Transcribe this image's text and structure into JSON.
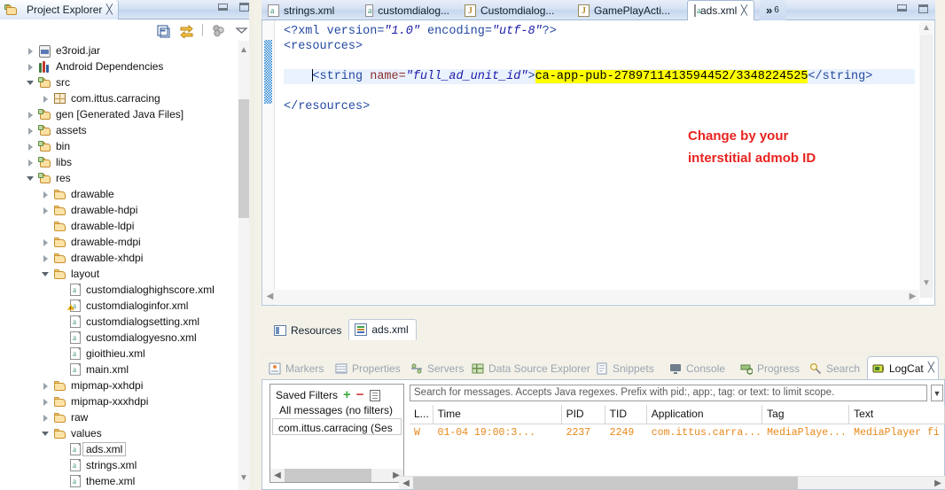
{
  "explorer": {
    "tab_title": "Project Explorer",
    "close_icon": "close-icon",
    "toolbar": [
      {
        "name": "collapse-all-icon",
        "tip": "Collapse All"
      },
      {
        "name": "link-with-editor-icon",
        "tip": "Link with Editor"
      },
      {
        "name": "filter-icon",
        "tip": "Filters"
      },
      {
        "name": "view-menu-icon",
        "tip": "View Menu"
      }
    ],
    "tree": [
      {
        "label": "e3roid.jar",
        "indent": 1,
        "twisty": "closed",
        "icon": "jar-icon"
      },
      {
        "label": "Android Dependencies",
        "indent": 1,
        "twisty": "closed",
        "icon": "library-icon"
      },
      {
        "label": "src",
        "indent": 1,
        "twisty": "open",
        "icon": "source-folder-icon"
      },
      {
        "label": "com.ittus.carracing",
        "indent": 2,
        "twisty": "closed",
        "icon": "package-icon"
      },
      {
        "label": "gen [Generated Java Files]",
        "indent": 1,
        "twisty": "closed",
        "icon": "source-folder-icon"
      },
      {
        "label": "assets",
        "indent": 1,
        "twisty": "closed",
        "icon": "source-folder-icon"
      },
      {
        "label": "bin",
        "indent": 1,
        "twisty": "closed",
        "icon": "source-folder-icon"
      },
      {
        "label": "libs",
        "indent": 1,
        "twisty": "closed",
        "icon": "source-folder-icon"
      },
      {
        "label": "res",
        "indent": 1,
        "twisty": "open",
        "icon": "source-folder-icon"
      },
      {
        "label": "drawable",
        "indent": 2,
        "twisty": "closed",
        "icon": "folder-icon"
      },
      {
        "label": "drawable-hdpi",
        "indent": 2,
        "twisty": "closed",
        "icon": "folder-icon"
      },
      {
        "label": "drawable-ldpi",
        "indent": 2,
        "twisty": "none",
        "icon": "folder-icon"
      },
      {
        "label": "drawable-mdpi",
        "indent": 2,
        "twisty": "closed",
        "icon": "folder-icon"
      },
      {
        "label": "drawable-xhdpi",
        "indent": 2,
        "twisty": "closed",
        "icon": "folder-icon"
      },
      {
        "label": "layout",
        "indent": 2,
        "twisty": "open",
        "icon": "folder-icon"
      },
      {
        "label": "customdialoghighscore.xml",
        "indent": 3,
        "twisty": "none",
        "icon": "xml-file-icon"
      },
      {
        "label": "customdialoginfor.xml",
        "indent": 3,
        "twisty": "none",
        "icon": "xml-file-warning-icon"
      },
      {
        "label": "customdialogsetting.xml",
        "indent": 3,
        "twisty": "none",
        "icon": "xml-file-icon"
      },
      {
        "label": "customdialogyesno.xml",
        "indent": 3,
        "twisty": "none",
        "icon": "xml-file-icon"
      },
      {
        "label": "gioithieu.xml",
        "indent": 3,
        "twisty": "none",
        "icon": "xml-file-icon"
      },
      {
        "label": "main.xml",
        "indent": 3,
        "twisty": "none",
        "icon": "xml-file-icon"
      },
      {
        "label": "mipmap-xxhdpi",
        "indent": 2,
        "twisty": "closed",
        "icon": "folder-icon"
      },
      {
        "label": "mipmap-xxxhdpi",
        "indent": 2,
        "twisty": "closed",
        "icon": "folder-icon"
      },
      {
        "label": "raw",
        "indent": 2,
        "twisty": "closed",
        "icon": "folder-icon"
      },
      {
        "label": "values",
        "indent": 2,
        "twisty": "open",
        "icon": "folder-icon"
      },
      {
        "label": "ads.xml",
        "indent": 3,
        "twisty": "none",
        "icon": "xml-file-icon",
        "selected": true
      },
      {
        "label": "strings.xml",
        "indent": 3,
        "twisty": "none",
        "icon": "xml-file-icon"
      },
      {
        "label": "theme.xml",
        "indent": 3,
        "twisty": "none",
        "icon": "xml-file-icon"
      }
    ]
  },
  "editor": {
    "tabs": [
      {
        "label": "strings.xml",
        "icon": "xml-file-icon",
        "active": false
      },
      {
        "label": "customdialog...",
        "icon": "xml-file-icon",
        "active": false
      },
      {
        "label": "Customdialog...",
        "icon": "java-file-icon",
        "active": false
      },
      {
        "label": "GamePlayActi...",
        "icon": "java-file-icon",
        "active": false
      },
      {
        "label": "ads.xml",
        "icon": "xml-file-icon",
        "active": true
      }
    ],
    "overflow_label": "»",
    "overflow_count": "6",
    "code": {
      "line1_decl": "<?xml version=",
      "line1_ver": "\"1.0\"",
      "line1_enc_attr": " encoding=",
      "line1_enc": "\"utf-8\"",
      "line1_end": "?>",
      "line2": "<resources>",
      "line4_tag_open": "<string ",
      "line4_attr": "name=",
      "line4_attr_val": "\"full_ad_unit_id\"",
      "line4_gt": ">",
      "line4_value": "ca-app-pub-2789711413594452/3348224525",
      "line4_close": "</string>",
      "line6": "</resources>"
    },
    "annotation_line1": "Change by your",
    "annotation_line2": "interstitial admob ID",
    "annotation_color": "#e8231f",
    "highlight_color": "#ffff00",
    "bottom_tabs": [
      {
        "label": "Resources",
        "icon": "resources-form-icon",
        "active": false
      },
      {
        "label": "ads.xml",
        "icon": "source-view-icon",
        "active": true
      }
    ]
  },
  "bottom_panel": {
    "tabs": [
      {
        "label": "Markers",
        "icon": "markers-icon",
        "active": false
      },
      {
        "label": "Properties",
        "icon": "properties-icon",
        "active": false
      },
      {
        "label": "Servers",
        "icon": "servers-icon",
        "active": false
      },
      {
        "label": "Data Source Explorer",
        "icon": "data-source-icon",
        "active": false
      },
      {
        "label": "Snippets",
        "icon": "snippets-icon",
        "active": false
      },
      {
        "label": "Console",
        "icon": "console-icon",
        "active": false
      },
      {
        "label": "Progress",
        "icon": "progress-icon",
        "active": false
      },
      {
        "label": "Search",
        "icon": "search-icon",
        "active": false
      },
      {
        "label": "LogCat",
        "icon": "logcat-icon",
        "active": true
      }
    ],
    "logcat": {
      "filters_title": "Saved Filters",
      "add_filter": "+",
      "remove_filter": "−",
      "edit_filter_icon": "edit-filter-icon",
      "filters": [
        {
          "label": "All messages (no filters)",
          "selected": false
        },
        {
          "label": "com.ittus.carracing (Ses",
          "selected": true
        }
      ],
      "search_placeholder": "Search for messages. Accepts Java regexes. Prefix with pid:, app:, tag: or text: to limit scope.",
      "level_dropdown_icon": "verbose-level-icon",
      "columns": [
        "L...",
        "Time",
        "PID",
        "TID",
        "Application",
        "Tag",
        "Text"
      ],
      "rows": [
        {
          "level": "W",
          "time": "01-04 19:00:3...",
          "pid": "2237",
          "tid": "2249",
          "application": "com.ittus.carra...",
          "tag": "MediaPlaye...",
          "text": "MediaPlayer fi",
          "color": "#e8881a"
        }
      ]
    }
  },
  "window": {
    "minimize_icon": "minimize-icon",
    "maximize_icon": "maximize-icon"
  }
}
